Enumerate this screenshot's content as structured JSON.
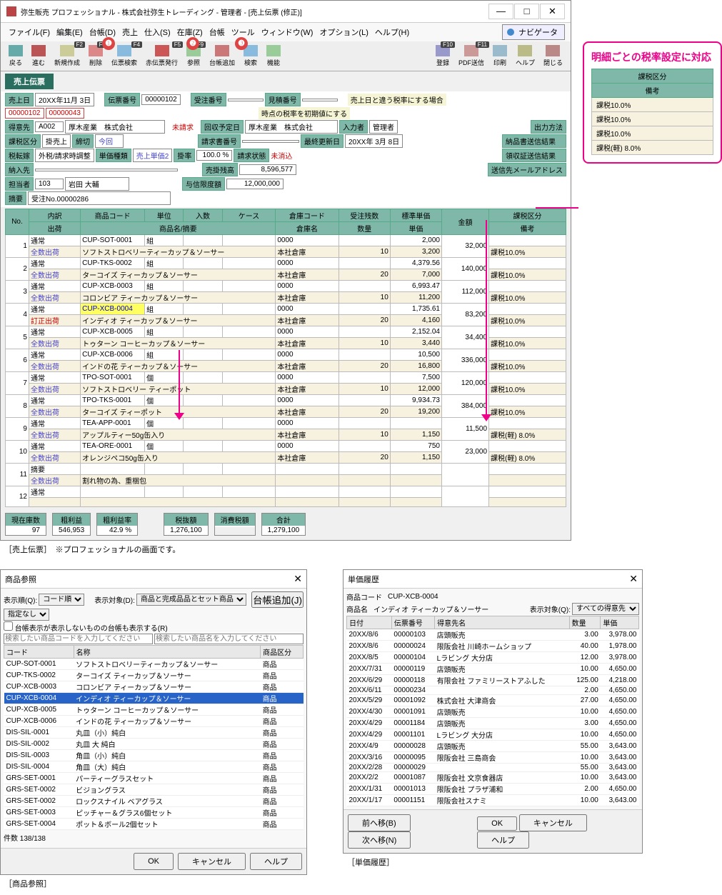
{
  "title": "弥生販売 プロフェッショナル - 株式会社弥生トレーディング - 管理者 - [売上伝票 (修正)]",
  "win": {
    "min": "—",
    "max": "□",
    "close": "✕"
  },
  "nav_btn": "ナビゲータ",
  "menu": [
    "ファイル(F)",
    "編集(E)",
    "台帳(D)",
    "売上",
    "仕入(S)",
    "在庫(Z)",
    "台帳",
    "ツール",
    "ウィンドウ(W)",
    "オプション(L)",
    "ヘルプ(H)"
  ],
  "toolbar_left": [
    {
      "k": "",
      "l": "戻る",
      "c": "#6aa"
    },
    {
      "k": "",
      "l": "進む",
      "c": "#b55"
    },
    {
      "k": "F2",
      "l": "新規作成",
      "c": "#cc9"
    },
    {
      "k": "F3",
      "l": "削除",
      "c": "#d88"
    },
    {
      "k": "F4",
      "l": "伝票検索",
      "c": "#8bd"
    },
    {
      "k": "F5",
      "l": "赤伝票発行",
      "c": "#c55"
    },
    {
      "k": "F9",
      "l": "参照",
      "c": "#9c9"
    },
    {
      "k": "",
      "l": "台帳追加",
      "c": "#c77"
    },
    {
      "k": "",
      "l": "検索",
      "c": "#8bd"
    },
    {
      "k": "",
      "l": "機能",
      "c": "#9c9"
    }
  ],
  "toolbar_right": [
    {
      "k": "F10",
      "l": "登録",
      "c": "#99c"
    },
    {
      "k": "F11",
      "l": "PDF送信",
      "c": "#c99"
    },
    {
      "k": "",
      "l": "印刷",
      "c": "#9bc"
    },
    {
      "k": "",
      "l": "ヘルプ",
      "c": "#bb8"
    },
    {
      "k": "",
      "l": "閉じる",
      "c": "#b88"
    }
  ],
  "callouts": {
    "1": "❶",
    "2": "❷",
    "3": "❸"
  },
  "sheet_tab": "売上伝票",
  "hdr": {
    "date_l": "売上日",
    "date": "20XX年11月 3日",
    "slip_l": "伝票番号",
    "slip": "00000102",
    "order_l": "受注番号",
    "order": "",
    "est_l": "見積番号",
    "est": "",
    "tax_note_a": "売上日と違う税率にする場合",
    "tax_note_b": "時点の税率を初期値にする",
    "cust_l": "得意先",
    "cust_cd": "A002",
    "cust_nm": "厚木産業　株式会社",
    "unbilled": "未請求",
    "taxtype_l": "課税区分",
    "taxtype": "掛売上",
    "shime_l": "締切",
    "shime": "今回",
    "bill_l": "回収予定日",
    "bill_nm": "厚木産業　株式会社",
    "tax_method_l": "税転嫁",
    "tax_method": "外税/請求時調整",
    "unit_kind_l": "単価種類",
    "unit_kind": "売上単価2",
    "rate_l": "掛率",
    "rate": "100.0 %",
    "invreq_l": "請求書番号",
    "lastupd_l": "最終更新日",
    "lastupd": "20XX年 3月 8日",
    "entry_l": "入力者",
    "entry": "管理者",
    "seikyu_l": "請求状態",
    "seikyu": "未消込",
    "nonyu_l": "納入先",
    "tanto_l": "担当者",
    "tanto_cd": "103",
    "tanto_nm": "岩田 大輔",
    "remain_l": "売掛残高",
    "remain": "8,596,577",
    "limit_l": "与信限度額",
    "limit": "12,000,000",
    "memo_l": "摘要",
    "memo": "受注No.00000286",
    "out_l": "出力方法",
    "out_a": "納品書送信結果",
    "out_b": "領収証送信結果",
    "out_c": "送信先メールアドレス"
  },
  "gridh": {
    "no": "No.",
    "inner": "内訳",
    "ship": "出荷",
    "code": "商品コード",
    "unit": "単位",
    "qty": "入数",
    "case": "ケース",
    "whcd": "倉庫コード",
    "name": "商品名/摘要",
    "whname": "倉庫名",
    "recvqty": "受注残数",
    "ship_qty": "数量",
    "std_price": "標準単価",
    "price": "単価",
    "amount": "金額",
    "tax": "課税区分",
    "note": "備考"
  },
  "rows": [
    {
      "no": 1,
      "a": "通常",
      "cd": "CUP-SOT-0001",
      "u": "組",
      "cs": "",
      "wc": "0000",
      "p": "2,000",
      "tax": "",
      "b": "全数出荷",
      "nm": "ソフトストロベリーティーカップ＆ソーサー",
      "wn": "本社倉庫",
      "q": "10",
      "up": "3,200",
      "amt": "32,000",
      "bt": "課税10.0%"
    },
    {
      "no": 2,
      "a": "通常",
      "cd": "CUP-TKS-0002",
      "u": "組",
      "cs": "",
      "wc": "0000",
      "p": "4,379.56",
      "tax": "",
      "b": "全数出荷",
      "nm": "ターコイズ ティーカップ＆ソーサー",
      "wn": "本社倉庫",
      "q": "20",
      "up": "7,000",
      "amt": "140,000",
      "bt": "課税10.0%"
    },
    {
      "no": 3,
      "a": "通常",
      "cd": "CUP-XCB-0003",
      "u": "組",
      "cs": "",
      "wc": "0000",
      "p": "6,993.47",
      "tax": "",
      "b": "全数出荷",
      "nm": "コロンビア ティーカップ＆ソーサー",
      "wn": "本社倉庫",
      "q": "10",
      "up": "11,200",
      "amt": "112,000",
      "bt": "課税10.0%"
    },
    {
      "no": 4,
      "a": "通常",
      "cd": "CUP-XCB-0004",
      "u": "組",
      "cs": "",
      "wc": "0000",
      "p": "1,735.61",
      "tax": "",
      "b": "訂正出荷",
      "nm": "インディオ ティーカップ＆ソーサー",
      "wn": "本社倉庫",
      "q": "20",
      "up": "4,160",
      "amt": "83,200",
      "bt": "課税10.0%",
      "hi": true
    },
    {
      "no": 5,
      "a": "通常",
      "cd": "CUP-XCB-0005",
      "u": "組",
      "cs": "",
      "wc": "0000",
      "p": "2,152.04",
      "tax": "",
      "b": "全数出荷",
      "nm": "トゥターン コーヒーカップ＆ソーサー",
      "wn": "本社倉庫",
      "q": "10",
      "up": "3,440",
      "amt": "34,400",
      "bt": "課税10.0%"
    },
    {
      "no": 6,
      "a": "通常",
      "cd": "CUP-XCB-0006",
      "u": "組",
      "cs": "",
      "wc": "0000",
      "p": "10,500",
      "tax": "",
      "b": "全数出荷",
      "nm": "インドの花 ティーカップ＆ソーサー",
      "wn": "本社倉庫",
      "q": "20",
      "up": "16,800",
      "amt": "336,000",
      "bt": "課税10.0%"
    },
    {
      "no": 7,
      "a": "通常",
      "cd": "TPO-SOT-0001",
      "u": "個",
      "cs": "",
      "wc": "0000",
      "p": "7,500",
      "tax": "",
      "b": "全数出荷",
      "nm": "ソフトストロベリー ティーポット",
      "wn": "本社倉庫",
      "q": "10",
      "up": "12,000",
      "amt": "120,000",
      "bt": "課税10.0%"
    },
    {
      "no": 8,
      "a": "通常",
      "cd": "TPO-TKS-0001",
      "u": "個",
      "cs": "",
      "wc": "0000",
      "p": "9,934.73",
      "tax": "",
      "b": "全数出荷",
      "nm": "ターコイズ ティーポット",
      "wn": "本社倉庫",
      "q": "20",
      "up": "19,200",
      "amt": "384,000",
      "bt": "課税10.0%"
    },
    {
      "no": 9,
      "a": "通常",
      "cd": "TEA-APP-0001",
      "u": "個",
      "cs": "",
      "wc": "0000",
      "p": "",
      "tax": "",
      "b": "全数出荷",
      "nm": "アップルティー50g缶入り",
      "wn": "本社倉庫",
      "q": "10",
      "up": "1,150",
      "amt": "11,500",
      "bt": "課税(軽) 8.0%"
    },
    {
      "no": 10,
      "a": "通常",
      "cd": "TEA-ORE-0001",
      "u": "個",
      "cs": "",
      "wc": "0000",
      "p": "750",
      "tax": "",
      "b": "全数出荷",
      "nm": "オレンジペコ50g缶入り",
      "wn": "本社倉庫",
      "q": "20",
      "up": "1,150",
      "amt": "23,000",
      "bt": "課税(軽) 8.0%"
    },
    {
      "no": 11,
      "a": "摘要",
      "cd": "",
      "u": "",
      "cs": "",
      "wc": "",
      "p": "",
      "tax": "",
      "b": "全数出荷",
      "nm": "割れ物の為、重梱包",
      "wn": "",
      "q": "",
      "up": "",
      "amt": "",
      "bt": ""
    },
    {
      "no": 12,
      "a": "通常",
      "cd": "",
      "u": "",
      "cs": "",
      "wc": "",
      "p": "",
      "tax": "",
      "b": "",
      "nm": "",
      "wn": "",
      "q": "",
      "up": "",
      "amt": "",
      "bt": ""
    }
  ],
  "summary": {
    "qty_l": "現在庫数",
    "qty": "97",
    "prof_l": "粗利益",
    "prof": "546,953",
    "profr_l": "粗利益率",
    "profr": "42.9 %",
    "net_l": "税抜額",
    "net": "1,276,100",
    "tax_l": "消費税額",
    "tax": "",
    "total_l": "合計",
    "total": "1,279,100"
  },
  "caption_main": "［売上伝票］　※プロフェッショナルの画面です。",
  "side": {
    "title": "明細ごとの税率設定に対応",
    "h1": "課税区分",
    "h2": "備考",
    "rows": [
      "課税10.0%",
      "課税10.0%",
      "課税10.0%",
      "課税(軽) 8.0%"
    ]
  },
  "ref": {
    "title": "商品参照",
    "order_l": "表示順(Q):",
    "order_sel": "コード順",
    "target_l": "表示対象(D):",
    "target_sel": "商品と完成品品とセット商品",
    "filter_sel": "指定なし",
    "addbtn": "台帳追加(J)",
    "chk": "台帳表示が表示しないものの台帳も表示する(R)",
    "ph1": "検索したい商品コードを入力してください",
    "ph2": "検索したい商品名を入力してください",
    "h": [
      "コード",
      "名称",
      "商品区分"
    ],
    "rows": [
      [
        "CUP-SOT-0001",
        "ソフトストロベリーティーカップ＆ソーサー",
        "商品"
      ],
      [
        "CUP-TKS-0002",
        "ターコイズ ティーカップ＆ソーサー",
        "商品"
      ],
      [
        "CUP-XCB-0003",
        "コロンビア ティーカップ＆ソーサー",
        "商品"
      ],
      [
        "CUP-XCB-0004",
        "インディオ ティーカップ＆ソーサー",
        "商品"
      ],
      [
        "CUP-XCB-0005",
        "トゥターン コーヒーカップ＆ソーサー",
        "商品"
      ],
      [
        "CUP-XCB-0006",
        "インドの花 ティーカップ＆ソーサー",
        "商品"
      ],
      [
        "DIS-SIL-0001",
        "丸皿（小）純白",
        "商品"
      ],
      [
        "DIS-SIL-0002",
        "丸皿  大  純白",
        "商品"
      ],
      [
        "DIS-SIL-0003",
        "角皿（小）純白",
        "商品"
      ],
      [
        "DIS-SIL-0004",
        "角皿（大）純白",
        "商品"
      ],
      [
        "GRS-SET-0001",
        "パーティーグラスセット",
        "商品"
      ],
      [
        "GRS-SET-0002",
        "ビジョングラス",
        "商品"
      ],
      [
        "GRS-SET-0002",
        "ロックスナイル  ベアグラス",
        "商品"
      ],
      [
        "GRS-SET-0003",
        "ピッチャー＆グラス6個セット",
        "商品"
      ],
      [
        "GRS-SET-0004",
        "ポット＆ボール2個セット",
        "商品"
      ]
    ],
    "count": "件数 138/138",
    "ok": "OK",
    "cancel": "キャンセル",
    "help": "ヘルプ",
    "caption": "［商品参照］"
  },
  "hist": {
    "title": "単価履歴",
    "code_l": "商品コード",
    "code": "CUP-XCB-0004",
    "name_l": "商品名",
    "name": "インディオ ティーカップ＆ソーサー",
    "target_l": "表示対象(Q):",
    "target_sel": "すべての得意先",
    "h": [
      "日付",
      "伝票番号",
      "得意先名",
      "数量",
      "単価"
    ],
    "rows": [
      [
        "20XX/8/6",
        "00000103",
        "店頭販売",
        "3.00",
        "3,978.00"
      ],
      [
        "20XX/8/6",
        "00000024",
        "限阪会社 川崎ホームショップ",
        "40.00",
        "1,978.00"
      ],
      [
        "20XX/8/5",
        "00000104",
        "Lラビング 大分店",
        "12.00",
        "3,978.00"
      ],
      [
        "20XX/7/31",
        "00000119",
        "店頭販売",
        "10.00",
        "4,650.00"
      ],
      [
        "20XX/6/29",
        "00000118",
        "有限会社 ファミリーストアふした",
        "125.00",
        "4,218.00"
      ],
      [
        "20XX/6/11",
        "00000234",
        "",
        "2.00",
        "4,650.00"
      ],
      [
        "20XX/5/29",
        "00001092",
        "株式会社 大津商会",
        "27.00",
        "4,650.00"
      ],
      [
        "20XX/4/30",
        "00001091",
        "店頭販売",
        "10.00",
        "4,650.00"
      ],
      [
        "20XX/4/29",
        "00001184",
        "店頭販売",
        "3.00",
        "4,650.00"
      ],
      [
        "20XX/4/29",
        "00001101",
        "Lラビング 大分店",
        "10.00",
        "4,650.00"
      ],
      [
        "20XX/4/9",
        "00000028",
        "店頭販売",
        "55.00",
        "3,643.00"
      ],
      [
        "20XX/3/16",
        "00000095",
        "限阪会社 三島商会",
        "10.00",
        "3,643.00"
      ],
      [
        "20XX/2/28",
        "00000029",
        "",
        "55.00",
        "3,643.00"
      ],
      [
        "20XX/2/2",
        "00001087",
        "限阪会社 文京食器店",
        "10.00",
        "3,643.00"
      ],
      [
        "20XX/1/31",
        "00001013",
        "限阪会社 プラザ浦和",
        "2.00",
        "4,650.00"
      ],
      [
        "20XX/1/17",
        "00001151",
        "限阪会社スナミ",
        "10.00",
        "3,643.00"
      ]
    ],
    "prev": "前へ移(B)",
    "next": "次へ移(N)",
    "ok": "OK",
    "cancel": "キャンセル",
    "help": "ヘルプ",
    "caption": "［単価履歴］"
  }
}
